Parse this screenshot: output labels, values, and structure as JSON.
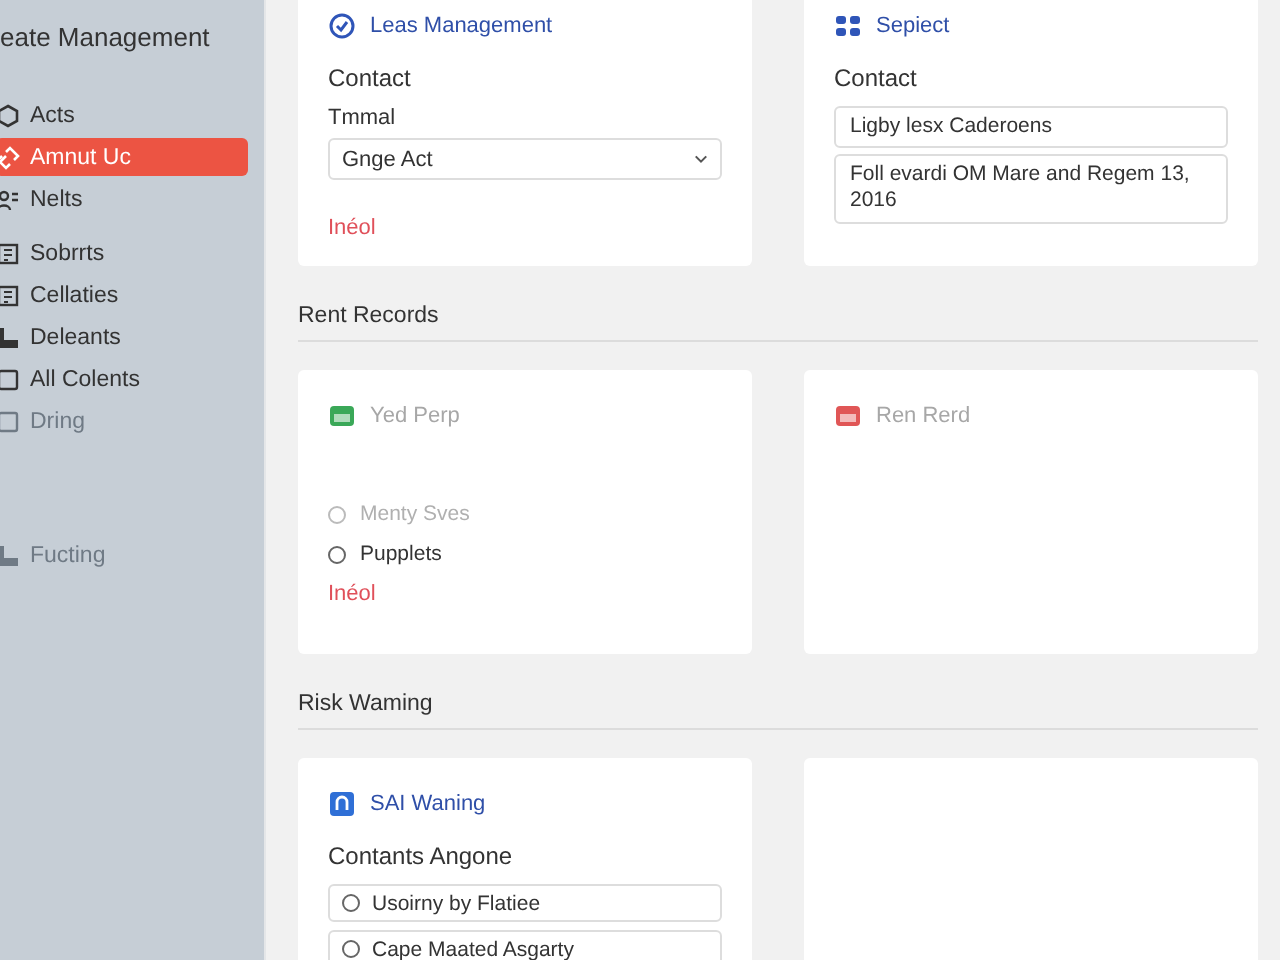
{
  "sidebar": {
    "title": "eate Management",
    "items": [
      {
        "label": "Acts",
        "selected": false,
        "disabled": false
      },
      {
        "label": "Amnut Uc",
        "selected": true,
        "disabled": false
      },
      {
        "label": "Nelts",
        "selected": false,
        "disabled": false
      },
      {
        "label": "Sobrrts",
        "selected": false,
        "disabled": false
      },
      {
        "label": "Cellaties",
        "selected": false,
        "disabled": false
      },
      {
        "label": "Deleants",
        "selected": false,
        "disabled": false
      },
      {
        "label": "All Colents",
        "selected": false,
        "disabled": false
      },
      {
        "label": "Dring",
        "selected": false,
        "disabled": true
      },
      {
        "label": "Fucting",
        "selected": false,
        "disabled": true
      }
    ]
  },
  "sections": [
    {
      "cards": [
        {
          "color": "#2f55b8",
          "title": "Leas Management",
          "disabled": false,
          "content": [
            {
              "kind": "heading",
              "text": "Contact"
            },
            {
              "kind": "label",
              "text": "Tmmal"
            },
            {
              "kind": "select",
              "value": "Gnge Act"
            },
            {
              "kind": "link",
              "text": "Inéol"
            }
          ]
        },
        {
          "color": "#2f55b8",
          "title": "Sepiect",
          "disabled": false,
          "content": [
            {
              "kind": "heading",
              "text": "Contact"
            },
            {
              "kind": "input",
              "value": "Ligby lesx Caderoens"
            },
            {
              "kind": "textarea",
              "value": "Foll evardi OM Mare and Regem 13, 2016"
            }
          ]
        }
      ]
    },
    {
      "heading": "Rent Records",
      "cards": [
        {
          "color": "#3aa858",
          "title": "Yed Perp",
          "disabled": true,
          "content": [
            {
              "kind": "radio",
              "text": "Menty Sves",
              "disabled": true
            },
            {
              "kind": "radio",
              "text": "Pupplets",
              "disabled": false
            },
            {
              "kind": "link",
              "text": "Inéol"
            }
          ]
        },
        {
          "color": "#e05656",
          "title": "Ren Rerd",
          "disabled": true
        }
      ]
    },
    {
      "heading": "Risk Waming",
      "cards": [
        {
          "color": "#2f6fd6",
          "title": "SAI Waning",
          "disabled": false,
          "content": [
            {
              "kind": "heading",
              "text": "Contants Angone"
            },
            {
              "kind": "radio-field",
              "text": "Usoirny by Flatiee"
            },
            {
              "kind": "radio-field",
              "text": "Cape Maated Asgarty"
            }
          ]
        }
      ]
    }
  ]
}
